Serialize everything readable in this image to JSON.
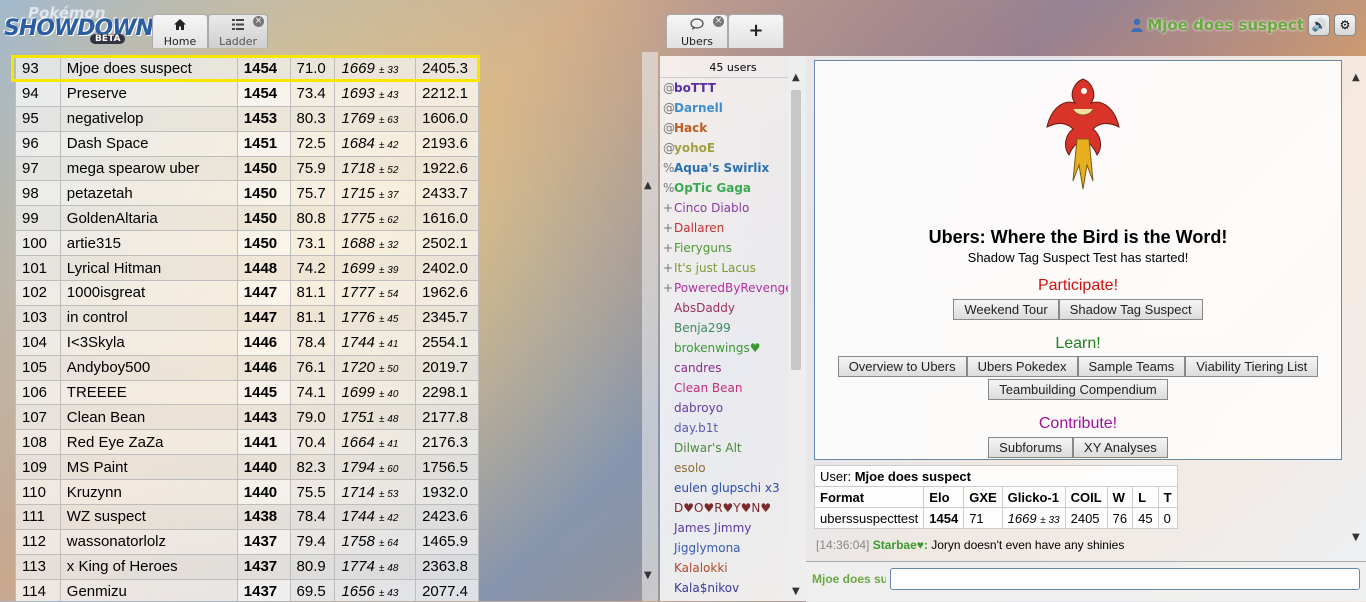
{
  "header": {
    "logo": {
      "line1": "Pokémon",
      "line2": "SHOWDOWN!",
      "badge": "BETA"
    },
    "tabs": [
      {
        "label": "Home",
        "icon": "home-icon"
      },
      {
        "label": "Ladder",
        "icon": "list-icon"
      }
    ],
    "close_glyph": "×",
    "user_name": "Mjoe does suspect",
    "sound_glyph": "🔊",
    "settings_glyph": "⚙"
  },
  "ladder": {
    "rows": [
      {
        "rank": "93",
        "name": "Mjoe does suspect",
        "elo": "1454",
        "gxe": "71.0",
        "glicko": "1669",
        "dev": "± 33",
        "coil": "2405.3"
      },
      {
        "rank": "94",
        "name": "Preserve",
        "elo": "1454",
        "gxe": "73.4",
        "glicko": "1693",
        "dev": "± 43",
        "coil": "2212.1"
      },
      {
        "rank": "95",
        "name": "negativelop",
        "elo": "1453",
        "gxe": "80.3",
        "glicko": "1769",
        "dev": "± 63",
        "coil": "1606.0"
      },
      {
        "rank": "96",
        "name": "Dash Space",
        "elo": "1451",
        "gxe": "72.5",
        "glicko": "1684",
        "dev": "± 42",
        "coil": "2193.6"
      },
      {
        "rank": "97",
        "name": "mega spearow uber",
        "elo": "1450",
        "gxe": "75.9",
        "glicko": "1718",
        "dev": "± 52",
        "coil": "1922.6"
      },
      {
        "rank": "98",
        "name": "petazetah",
        "elo": "1450",
        "gxe": "75.7",
        "glicko": "1715",
        "dev": "± 37",
        "coil": "2433.7"
      },
      {
        "rank": "99",
        "name": "GoldenAltaria",
        "elo": "1450",
        "gxe": "80.8",
        "glicko": "1775",
        "dev": "± 62",
        "coil": "1616.0"
      },
      {
        "rank": "100",
        "name": "artie315",
        "elo": "1450",
        "gxe": "73.1",
        "glicko": "1688",
        "dev": "± 32",
        "coil": "2502.1"
      },
      {
        "rank": "101",
        "name": "Lyrical Hitman",
        "elo": "1448",
        "gxe": "74.2",
        "glicko": "1699",
        "dev": "± 39",
        "coil": "2402.0"
      },
      {
        "rank": "102",
        "name": "1000isgreat",
        "elo": "1447",
        "gxe": "81.1",
        "glicko": "1777",
        "dev": "± 54",
        "coil": "1962.6"
      },
      {
        "rank": "103",
        "name": "in control",
        "elo": "1447",
        "gxe": "81.1",
        "glicko": "1776",
        "dev": "± 45",
        "coil": "2345.7"
      },
      {
        "rank": "104",
        "name": "I<3Skyla",
        "elo": "1446",
        "gxe": "78.4",
        "glicko": "1744",
        "dev": "± 41",
        "coil": "2554.1"
      },
      {
        "rank": "105",
        "name": "Andyboy500",
        "elo": "1446",
        "gxe": "76.1",
        "glicko": "1720",
        "dev": "± 50",
        "coil": "2019.7"
      },
      {
        "rank": "106",
        "name": "TREEEE",
        "elo": "1445",
        "gxe": "74.1",
        "glicko": "1699",
        "dev": "± 40",
        "coil": "2298.1"
      },
      {
        "rank": "107",
        "name": "Clean Bean",
        "elo": "1443",
        "gxe": "79.0",
        "glicko": "1751",
        "dev": "± 48",
        "coil": "2177.8"
      },
      {
        "rank": "108",
        "name": "Red Eye ZaZa",
        "elo": "1441",
        "gxe": "70.4",
        "glicko": "1664",
        "dev": "± 41",
        "coil": "2176.3"
      },
      {
        "rank": "109",
        "name": "MS Paint",
        "elo": "1440",
        "gxe": "82.3",
        "glicko": "1794",
        "dev": "± 60",
        "coil": "1756.5"
      },
      {
        "rank": "110",
        "name": "Kruzynn",
        "elo": "1440",
        "gxe": "75.5",
        "glicko": "1714",
        "dev": "± 53",
        "coil": "1932.0"
      },
      {
        "rank": "111",
        "name": "WZ suspect",
        "elo": "1438",
        "gxe": "78.4",
        "glicko": "1744",
        "dev": "± 42",
        "coil": "2423.6"
      },
      {
        "rank": "112",
        "name": "wassonatorlolz",
        "elo": "1437",
        "gxe": "79.4",
        "glicko": "1758",
        "dev": "± 64",
        "coil": "1465.9"
      },
      {
        "rank": "113",
        "name": "x King of Heroes",
        "elo": "1437",
        "gxe": "80.9",
        "glicko": "1774",
        "dev": "± 48",
        "coil": "2363.8"
      },
      {
        "rank": "114",
        "name": "Genmizu",
        "elo": "1437",
        "gxe": "69.5",
        "glicko": "1656",
        "dev": "± 43",
        "coil": "2077.4"
      }
    ]
  },
  "room": {
    "tabs": [
      {
        "label": "Ubers",
        "icon": "chat-bubble-icon"
      },
      {
        "label": "+",
        "icon": "plus-icon"
      }
    ],
    "user_count": "45 users",
    "users": [
      {
        "group": "@",
        "name": "boTTT",
        "color": "#5a2fa0",
        "bold": true
      },
      {
        "group": "@",
        "name": "Darnell",
        "color": "#3a8fd0",
        "bold": true
      },
      {
        "group": "@",
        "name": "Hack",
        "color": "#c05a20",
        "bold": true
      },
      {
        "group": "@",
        "name": "yohoE",
        "color": "#a0a040",
        "bold": true
      },
      {
        "group": "%",
        "name": "Aqua's Swirlix",
        "color": "#2a6fb0",
        "bold": true
      },
      {
        "group": "%",
        "name": "OpTic Gaga",
        "color": "#3aaa50",
        "bold": true
      },
      {
        "group": "+",
        "name": "Cinco Diablo",
        "color": "#8a3aa0",
        "bold": false
      },
      {
        "group": "+",
        "name": "Dallaren",
        "color": "#c03030",
        "bold": false
      },
      {
        "group": "+",
        "name": "Fieryguns",
        "color": "#4a9a30",
        "bold": false
      },
      {
        "group": "+",
        "name": "It's just Lacus",
        "color": "#7a9a30",
        "bold": false
      },
      {
        "group": "+",
        "name": "PoweredByRevenge",
        "color": "#b030a0",
        "bold": false
      },
      {
        "group": "",
        "name": "AbsDaddy",
        "color": "#9a3060",
        "bold": false
      },
      {
        "group": "",
        "name": "Benja299",
        "color": "#3a8a60",
        "bold": false
      },
      {
        "group": "",
        "name": "brokenwings♥",
        "color": "#3a9a30",
        "bold": false
      },
      {
        "group": "",
        "name": "candres",
        "color": "#8a2a8a",
        "bold": false
      },
      {
        "group": "",
        "name": "Clean Bean",
        "color": "#c0307a",
        "bold": false
      },
      {
        "group": "",
        "name": "dabroyo",
        "color": "#6a3aa0",
        "bold": false
      },
      {
        "group": "",
        "name": "day.b1t",
        "color": "#5a5ab0",
        "bold": false
      },
      {
        "group": "",
        "name": "Dilwar's Alt",
        "color": "#4a8a3a",
        "bold": false
      },
      {
        "group": "",
        "name": "esolo",
        "color": "#8a6a30",
        "bold": false
      },
      {
        "group": "",
        "name": "eulen glupschi x3",
        "color": "#2a4ab0",
        "bold": false
      },
      {
        "group": "",
        "name": "D♥O♥R♥Y♥N♥",
        "color": "#7a2a2a",
        "bold": false
      },
      {
        "group": "",
        "name": "James Jimmy",
        "color": "#5a3aa0",
        "bold": false
      },
      {
        "group": "",
        "name": "Jigglymona",
        "color": "#3a5ab0",
        "bold": false
      },
      {
        "group": "",
        "name": "Kalalokki",
        "color": "#b04a2a",
        "bold": false
      },
      {
        "group": "",
        "name": "Kala$nikov",
        "color": "#3a3a9a",
        "bold": false
      }
    ],
    "intro": {
      "title": "Ubers: Where the Bird is the Word!",
      "subtitle": "Shadow Tag Suspect Test has started!",
      "participate_label": "Participate!",
      "participate_buttons": [
        "Weekend Tour",
        "Shadow Tag Suspect"
      ],
      "learn_label": "Learn!",
      "learn_buttons_row1": [
        "Overview to Ubers",
        "Ubers Pokedex",
        "Sample Teams",
        "Viability Tiering List"
      ],
      "learn_buttons_row2": [
        "Teambuilding Compendium"
      ],
      "contribute_label": "Contribute!",
      "contribute_buttons": [
        "Subforums",
        "XY Analyses"
      ],
      "colors": {
        "participate": "#d01010",
        "learn": "#208020",
        "contribute": "#a010a0"
      }
    },
    "stats": {
      "user_label": "User:",
      "user_name": "Mjoe does suspect",
      "headers": [
        "Format",
        "Elo",
        "GXE",
        "Glicko-1",
        "COIL",
        "W",
        "L",
        "T"
      ],
      "row": {
        "format": "uberssuspecttest",
        "elo": "1454",
        "gxe": "71",
        "glicko": "1669",
        "dev": "± 33",
        "coil": "2405",
        "w": "76",
        "l": "45",
        "t": "0"
      }
    },
    "chat": [
      {
        "time": "[14:36:04]",
        "user": "Starbae♥:",
        "message": "Joryn doesn't even have any shinies",
        "user_color": "#3a9a30"
      }
    ],
    "input": {
      "who": "Mjoe does suspect",
      "value": ""
    }
  }
}
